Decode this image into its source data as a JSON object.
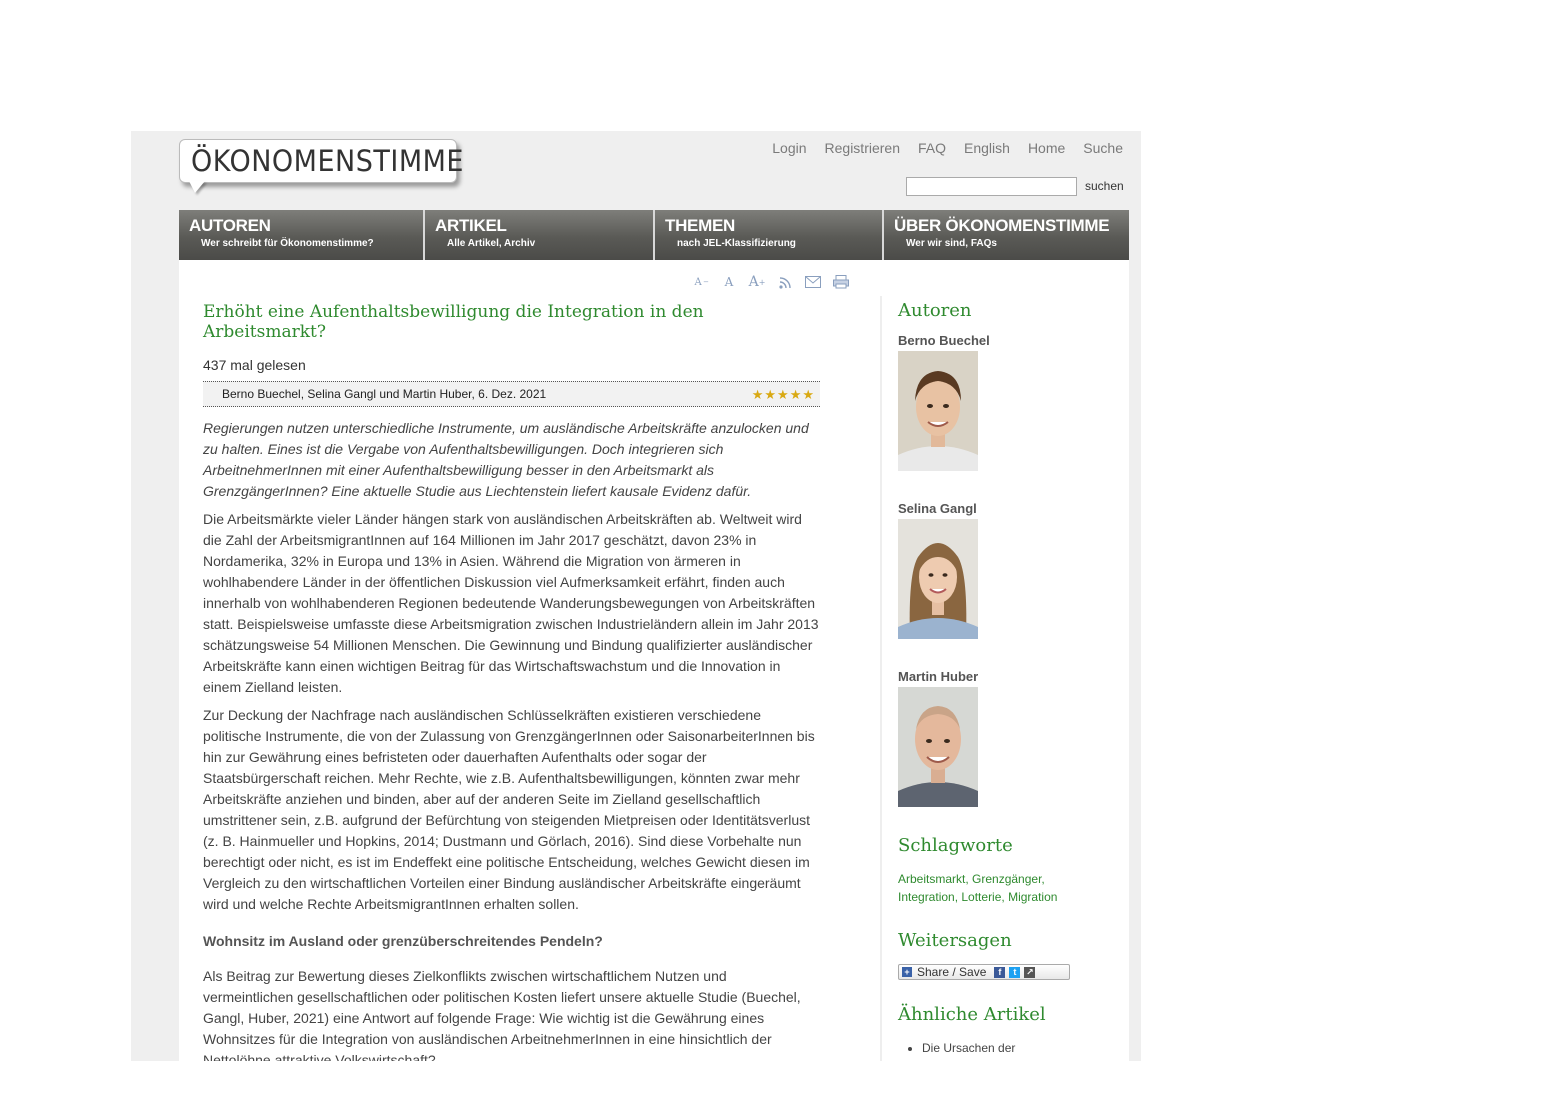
{
  "header": {
    "logo_text": "ÖKONOMENSTIMME",
    "top_nav": [
      "Login",
      "Registrieren",
      "FAQ",
      "English",
      "Home",
      "Suche"
    ],
    "search_button": "suchen",
    "search_value": ""
  },
  "main_nav": [
    {
      "title": "AUTOREN",
      "subtitle": "Wer schreibt für Ökonomenstimme?"
    },
    {
      "title": "ARTIKEL",
      "subtitle": "Alle Artikel, Archiv"
    },
    {
      "title": "THEMEN",
      "subtitle": "nach JEL-Klassifizierung"
    },
    {
      "title": "ÜBER ÖKONOMENSTIMME",
      "subtitle": "Wer wir sind, FAQs"
    }
  ],
  "tools": {
    "decrease": "A",
    "reset": "A",
    "increase": "A",
    "icons": [
      "font-decrease-icon",
      "font-reset-icon",
      "font-increase-icon",
      "rss-icon",
      "email-icon",
      "print-icon"
    ]
  },
  "article": {
    "title": "Erhöht eine Aufenthaltsbewilligung die Integration in den Arbeitsmarkt?",
    "read_count": "437 mal gelesen",
    "byline": "Berno Buechel, Selina Gangl und Martin Huber, 6. Dez. 2021",
    "rating_stars": 5,
    "lead": "Regierungen nutzen unterschiedliche Instrumente, um ausländische Arbeitskräfte anzulocken und zu halten. Eines ist die Vergabe von Aufenthaltsbewilligungen. Doch integrieren sich ArbeitnehmerInnen mit einer Aufenthaltsbewilligung besser in den Arbeitsmarkt als GrenzgängerInnen? Eine aktuelle Studie aus Liechtenstein liefert kausale Evidenz dafür.",
    "paragraph1": "Die Arbeitsmärkte vieler Länder hängen stark von ausländischen Arbeitskräften ab. Weltweit wird die Zahl der ArbeitsmigrantInnen auf 164 Millionen im Jahr 2017 geschätzt, davon 23% in Nordamerika, 32% in Europa und 13% in Asien. Während die Migration von ärmeren in wohlhabendere Länder in der öffentlichen Diskussion viel Aufmerksamkeit erfährt, finden auch innerhalb von wohlhabenderen Regionen bedeutende Wanderungsbewegungen von Arbeitskräften statt. Beispielsweise umfasste diese Arbeitsmigration zwischen Industrieländern allein im Jahr 2013 schätzungsweise 54 Millionen Menschen. Die Gewinnung und Bindung qualifizierter ausländischer Arbeitskräfte kann einen wichtigen Beitrag für das Wirtschaftswachstum und die Innovation in einem Zielland leisten.",
    "paragraph2": "Zur Deckung der Nachfrage nach ausländischen Schlüsselkräften existieren verschiedene politische Instrumente, die von der Zulassung von GrenzgängerInnen oder SaisonarbeiterInnen bis hin zur Gewährung eines befristeten oder dauerhaften Aufenthalts oder sogar der Staatsbürgerschaft reichen. Mehr Rechte, wie z.B. Aufenthaltsbewilligungen, könnten zwar mehr Arbeitskräfte anziehen und binden, aber auf der anderen Seite im Zielland gesellschaftlich umstrittener sein, z.B. aufgrund der Befürchtung von steigenden Mietpreisen oder Identitätsverlust (z. B. Hainmueller und Hopkins, 2014; Dustmann und Görlach, 2016). Sind diese Vorbehalte nun berechtigt oder nicht, es ist im Endeffekt eine politische Entscheidung, welches Gewicht diesen im Vergleich zu den wirtschaftlichen Vorteilen einer Bindung ausländischer Arbeitskräfte eingeräumt wird und welche Rechte ArbeitsmigrantInnen erhalten sollen.",
    "subheading": "Wohnsitz im Ausland oder grenzüberschreitendes Pendeln?",
    "paragraph3": "Als Beitrag zur Bewertung dieses Zielkonflikts zwischen wirtschaftlichem Nutzen und vermeintlichen gesellschaftlichen oder politischen Kosten liefert unsere aktuelle Studie (Buechel, Gangl, Huber, 2021) eine Antwort auf folgende Frage: Wie wichtig ist die Gewährung eines Wohnsitzes für die Integration von ausländischen ArbeitnehmerInnen in eine hinsichtlich der Nettolöhne attraktive Volkswirtschaft?"
  },
  "sidebar": {
    "authors_heading": "Autoren",
    "authors": [
      {
        "name": "Berno Buechel",
        "hair": "#5a3a22",
        "shirt": "#e9e9e9"
      },
      {
        "name": "Selina Gangl",
        "hair": "#8a6640",
        "shirt": "#9bb3cf"
      },
      {
        "name": "Martin Huber",
        "hair": "#c9a488",
        "shirt": "#5d6470"
      }
    ],
    "tags_heading": "Schlagworte",
    "tags_line1": "Arbeitsmarkt, Grenzgänger,",
    "tags_line2": "Integration, Lotterie, Migration",
    "share_heading": "Weitersagen",
    "share_label": "Share / Save",
    "related_heading": "Ähnliche Artikel",
    "related_items": [
      "Die Ursachen der"
    ]
  },
  "colors": {
    "accent_green": "#2f8a2f",
    "frame_bg": "#efefef",
    "nav_bg": "#5a5a56"
  }
}
